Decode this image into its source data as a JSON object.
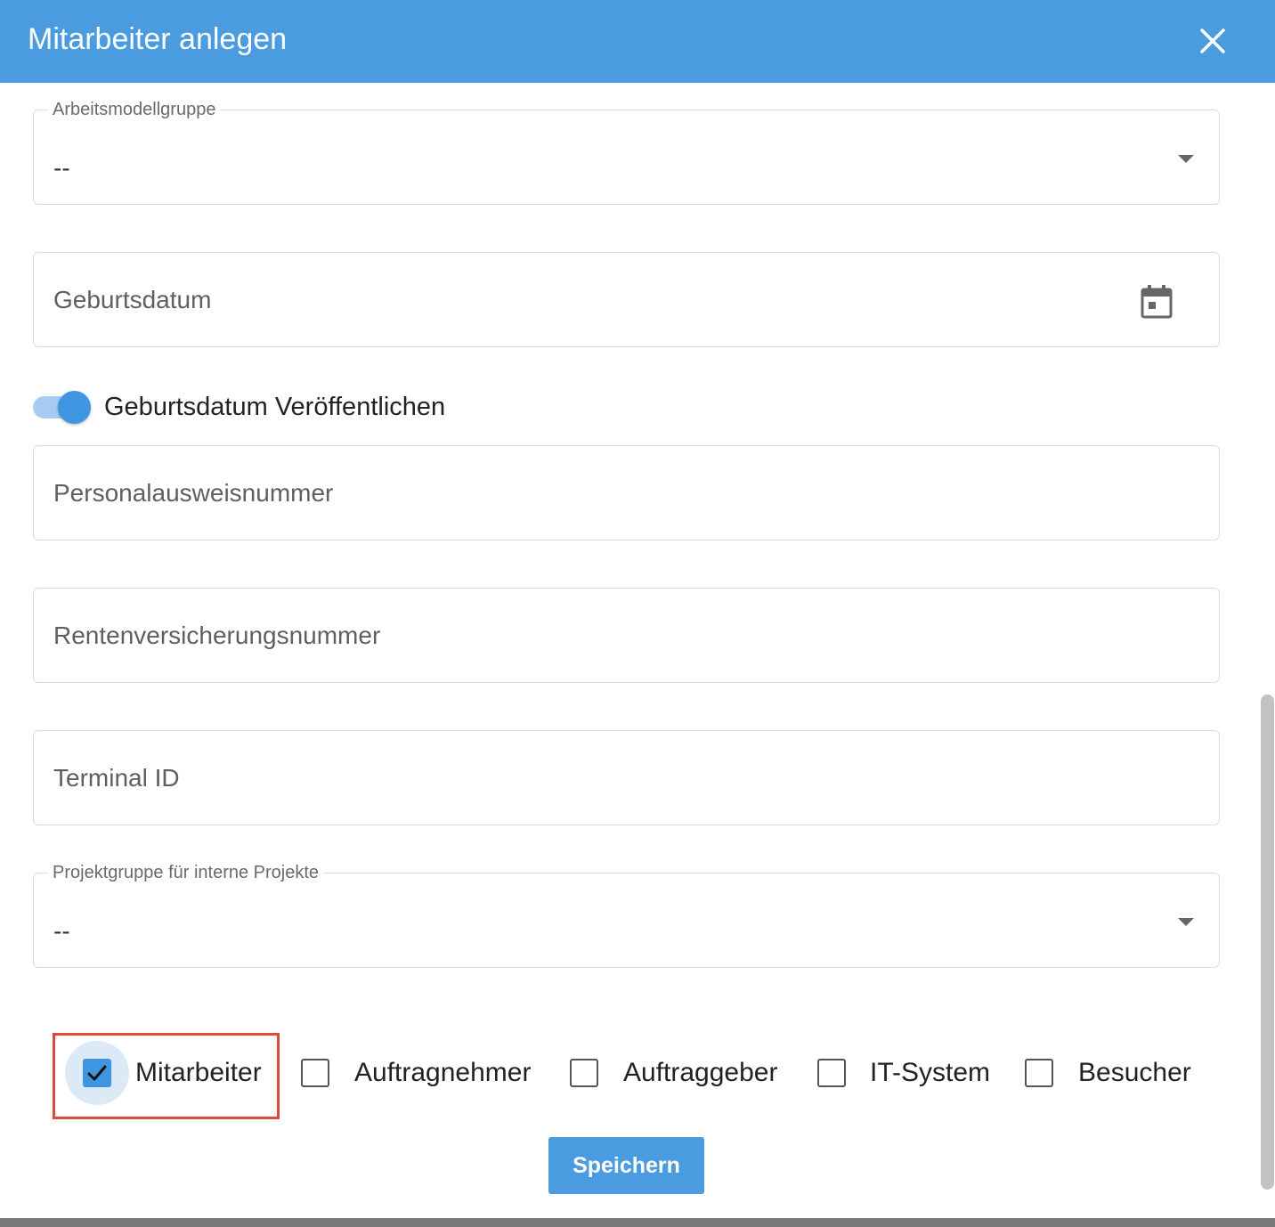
{
  "dialog": {
    "title": "Mitarbeiter anlegen",
    "header_color": "#4a9bdf",
    "close_icon": "close-icon"
  },
  "fields": {
    "arbeitsmodellgruppe": {
      "label": "Arbeitsmodellgruppe",
      "value": "--"
    },
    "geburtsdatum": {
      "placeholder": "Geburtsdatum",
      "icon": "calendar-icon"
    },
    "personalausweisnummer": {
      "placeholder": "Personalausweisnummer"
    },
    "rentenversicherungsnummer": {
      "placeholder": "Rentenversicherungsnummer"
    },
    "terminal_id": {
      "placeholder": "Terminal ID"
    },
    "projektgruppe": {
      "label": "Projektgruppe für interne Projekte",
      "value": "--"
    }
  },
  "toggle": {
    "label": "Geburtsdatum Veröffentlichen",
    "on": true
  },
  "checkboxes": [
    {
      "label": "Mitarbeiter",
      "checked": true
    },
    {
      "label": "Auftragnehmer",
      "checked": false
    },
    {
      "label": "Auftraggeber",
      "checked": false
    },
    {
      "label": "IT-System",
      "checked": false
    },
    {
      "label": "Besucher",
      "checked": false
    }
  ],
  "actions": {
    "save_label": "Speichern"
  },
  "colors": {
    "accent": "#4a9bdf",
    "highlight": "#e0483a"
  }
}
